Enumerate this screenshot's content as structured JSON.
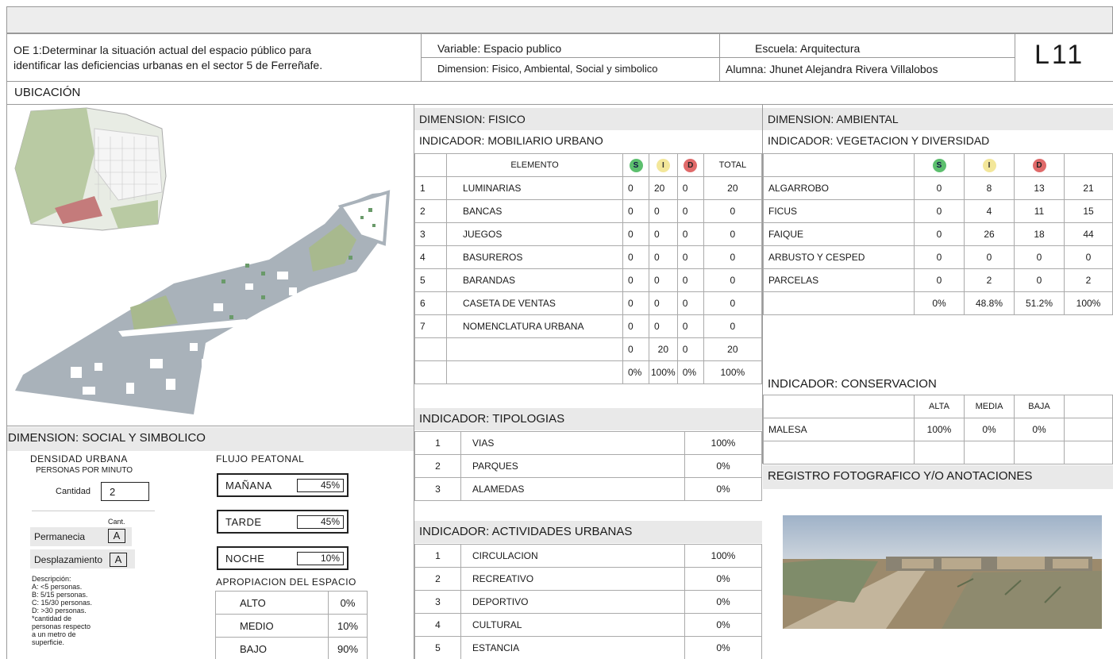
{
  "header": {
    "objective": "OE 1:Determinar la situación actual del espacio público para identificar las deficiencias urbanas en el sector 5 de Ferreñafe.",
    "objective_line1": "OE 1:Determinar la situación actual del espacio público para",
    "objective_line2": "identificar las deficiencias urbanas en el sector 5 de Ferreñafe.",
    "variable": "Variable: Espacio publico",
    "dimension": "Dimension: Fisico, Ambiental, Social y simbolico",
    "escuela": "Escuela: Arquitectura",
    "alumna": "Alumna: Jhunet Alejandra Rivera Villalobos",
    "code": "L11"
  },
  "ubicacion": {
    "title": "UBICACIÓN"
  },
  "fisico": {
    "title": "DIMENSION: FISICO",
    "indicator": "INDICADOR: MOBILIARIO URBANO",
    "headers": {
      "elemento": "ELEMENTO",
      "s": "S",
      "i": "I",
      "d": "D",
      "total": "TOTAL"
    },
    "rows": [
      {
        "n": "1",
        "name": "LUMINARIAS",
        "s": "0",
        "i": "20",
        "d": "0",
        "total": "20"
      },
      {
        "n": "2",
        "name": "BANCAS",
        "s": "0",
        "i": "0",
        "d": "0",
        "total": "0"
      },
      {
        "n": "3",
        "name": "JUEGOS",
        "s": "0",
        "i": "0",
        "d": "0",
        "total": "0"
      },
      {
        "n": "4",
        "name": "BASUREROS",
        "s": "0",
        "i": "0",
        "d": "0",
        "total": "0"
      },
      {
        "n": "5",
        "name": "BARANDAS",
        "s": "0",
        "i": "0",
        "d": "0",
        "total": "0"
      },
      {
        "n": "6",
        "name": "CASETA DE VENTAS",
        "s": "0",
        "i": "0",
        "d": "0",
        "total": "0"
      },
      {
        "n": "7",
        "name": "NOMENCLATURA URBANA",
        "s": "0",
        "i": "0",
        "d": "0",
        "total": "0"
      }
    ],
    "sum": {
      "s": "0",
      "i": "20",
      "d": "0",
      "total": "20"
    },
    "pct": {
      "s": "0%",
      "i": "100%",
      "d": "0%",
      "total": "100%"
    }
  },
  "tipologias": {
    "title": "INDICADOR: TIPOLOGIAS",
    "rows": [
      {
        "n": "1",
        "name": "VIAS",
        "pct": "100%"
      },
      {
        "n": "2",
        "name": "PARQUES",
        "pct": "0%"
      },
      {
        "n": "3",
        "name": "ALAMEDAS",
        "pct": "0%"
      }
    ]
  },
  "actividades": {
    "title": "INDICADOR: ACTIVIDADES URBANAS",
    "rows": [
      {
        "n": "1",
        "name": "CIRCULACION",
        "pct": "100%"
      },
      {
        "n": "2",
        "name": "RECREATIVO",
        "pct": "0%"
      },
      {
        "n": "3",
        "name": "DEPORTIVO",
        "pct": "0%"
      },
      {
        "n": "4",
        "name": "CULTURAL",
        "pct": "0%"
      },
      {
        "n": "5",
        "name": "ESTANCIA",
        "pct": "0%"
      }
    ]
  },
  "ambiental": {
    "title": "DIMENSION: AMBIENTAL",
    "indicator": "INDICADOR: VEGETACION Y DIVERSIDAD",
    "headers": {
      "s": "S",
      "i": "I",
      "d": "D"
    },
    "rows": [
      {
        "name": "ALGARROBO",
        "s": "0",
        "i": "8",
        "d": "13",
        "total": "21"
      },
      {
        "name": "FICUS",
        "s": "0",
        "i": "4",
        "d": "11",
        "total": "15"
      },
      {
        "name": "FAIQUE",
        "s": "0",
        "i": "26",
        "d": "18",
        "total": "44"
      },
      {
        "name": "ARBUSTO Y CESPED",
        "s": "0",
        "i": "0",
        "d": "0",
        "total": "0"
      },
      {
        "name": "PARCELAS",
        "s": "0",
        "i": "2",
        "d": "0",
        "total": "2"
      }
    ],
    "pct": {
      "s": "0%",
      "i": "48.8%",
      "d": "51.2%",
      "total": "100%"
    }
  },
  "conservacion": {
    "title": "INDICADOR: CONSERVACION",
    "headers": {
      "alta": "ALTA",
      "media": "MEDIA",
      "baja": "BAJA"
    },
    "row": {
      "name": "MALESA",
      "alta": "100%",
      "media": "0%",
      "baja": "0%"
    }
  },
  "registro": {
    "title": "REGISTRO FOTOGRAFICO Y/O ANOTACIONES"
  },
  "social": {
    "title": "DIMENSION: SOCIAL Y SIMBOLICO",
    "densidad_title": "DENSIDAD URBANA",
    "densidad_sub": "PERSONAS POR MINUTO",
    "cantidad_label": "Cantidad",
    "cantidad_value": "2",
    "cant_label": "Cant.",
    "permanencia_label": "Permanecia",
    "permanencia_value": "A",
    "desplazamiento_label": "Desplazamiento",
    "desplazamiento_value": "A",
    "descripcion": [
      "Descripción:",
      "A: <5 personas.",
      "B: 5/15 personas.",
      "C: 15/30 personas.",
      "D: >30 personas.",
      "*cantidad de",
      "personas respecto",
      "a un metro  de",
      "superficie."
    ],
    "flujo_title": "FLUJO PEATONAL",
    "flujo": [
      {
        "label": "MAÑANA",
        "value": "45%"
      },
      {
        "label": "TARDE",
        "value": "45%"
      },
      {
        "label": "NOCHE",
        "value": "10%"
      }
    ],
    "apropiacion_title": "APROPIACION DEL ESPACIO",
    "apropiacion": [
      {
        "label": "ALTO",
        "value": "0%"
      },
      {
        "label": "MEDIO",
        "value": "10%"
      },
      {
        "label": "BAJO",
        "value": "90%"
      }
    ]
  }
}
